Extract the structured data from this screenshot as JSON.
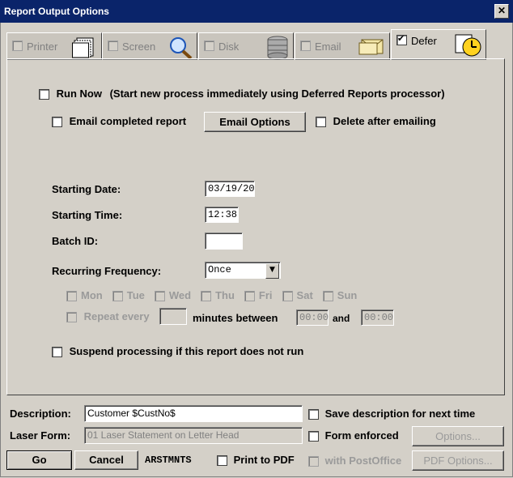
{
  "window": {
    "title": "Report Output Options",
    "close": "✕"
  },
  "tabs": [
    {
      "label": "Printer",
      "checked": false,
      "active": false
    },
    {
      "label": "Screen",
      "checked": false,
      "active": false
    },
    {
      "label": "Disk",
      "checked": false,
      "active": false
    },
    {
      "label": "Email",
      "checked": false,
      "active": false
    },
    {
      "label": "Defer",
      "checked": true,
      "active": true
    }
  ],
  "defer": {
    "run_now_label": "Run Now",
    "run_now_desc": "(Start new process immediately using Deferred Reports processor)",
    "email_completed_label": "Email completed report",
    "email_options_button": "Email Options",
    "delete_after_label": "Delete after emailing",
    "starting_date_label": "Starting Date:",
    "starting_date_value": "03/19/20",
    "starting_time_label": "Starting Time:",
    "starting_time_value": "12:38",
    "batch_id_label": "Batch ID:",
    "batch_id_value": "",
    "recurring_label": "Recurring Frequency:",
    "recurring_value": "Once",
    "days": [
      "Mon",
      "Tue",
      "Wed",
      "Thu",
      "Fri",
      "Sat",
      "Sun"
    ],
    "repeat_every_label": "Repeat every",
    "minutes_between_label": "minutes between",
    "repeat_minutes_value": "",
    "between_start": "00:00",
    "and_label": "and",
    "between_end": "00:00",
    "suspend_label": "Suspend processing if this report does not run"
  },
  "footer": {
    "description_label": "Description:",
    "description_value": "Customer $CustNo$",
    "save_desc_label": "Save description for next time",
    "laser_form_label": "Laser Form:",
    "laser_form_value": "01 Laser Statement on Letter Head",
    "form_enforced_label": "Form enforced",
    "options_button": "Options...",
    "go_button": "Go",
    "cancel_button": "Cancel",
    "report_code": "ARSTMNTS",
    "print_pdf_label": "Print to PDF",
    "with_postoffice_label": "with PostOffice",
    "pdf_options_button": "PDF Options..."
  }
}
